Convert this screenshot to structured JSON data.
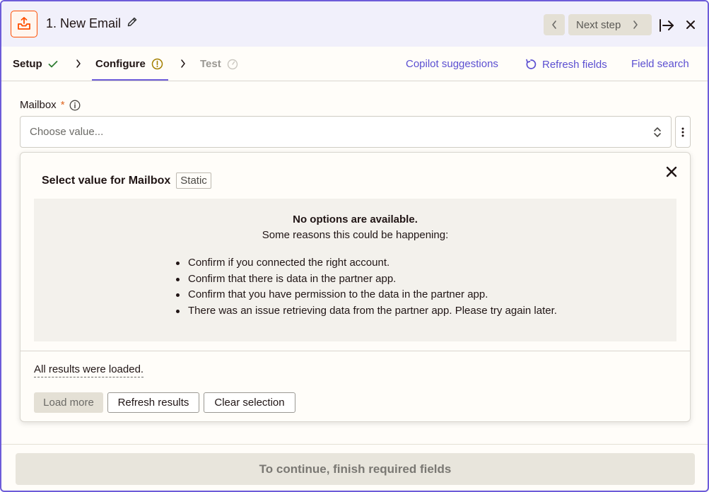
{
  "header": {
    "app_icon": "email-outbox-icon",
    "step_title": "1. New Email",
    "edit_icon": "pencil-icon",
    "next_step_label": "Next step",
    "accent_color": "#ff4f00"
  },
  "tabs": [
    {
      "label": "Setup",
      "status_icon": "check-icon",
      "status_color": "#2e7d32"
    },
    {
      "label": "Configure",
      "status_icon": "warning-circle-icon",
      "status_color": "#a37f00"
    },
    {
      "label": "Test",
      "status_icon": "timer-icon",
      "status_color": "#c9c6bf"
    }
  ],
  "toolbar": {
    "copilot_label": "Copilot suggestions",
    "refresh_fields_label": "Refresh fields",
    "field_search_label": "Field search",
    "link_color": "#5b4fd1"
  },
  "field": {
    "label": "Mailbox",
    "required_mark": "*",
    "placeholder": "Choose value..."
  },
  "popup": {
    "title": "Select value for Mailbox",
    "badge": "Static",
    "empty_title": "No options are available.",
    "empty_subtitle": "Some reasons this could be happening:",
    "reasons": [
      "Confirm if you connected the right account.",
      "Confirm that there is data in the partner app.",
      "Confirm that you have permission to the data in the partner app.",
      "There was an issue retrieving data from the partner app. Please try again later."
    ],
    "loaded_text": "All results were loaded.",
    "load_more_label": "Load more",
    "refresh_results_label": "Refresh results",
    "clear_selection_label": "Clear selection"
  },
  "footer": {
    "continue_label": "To continue, finish required fields"
  }
}
